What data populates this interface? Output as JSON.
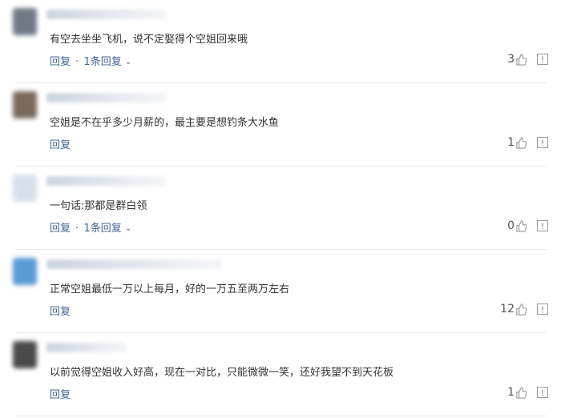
{
  "comments": [
    {
      "text": "有空去坐坐飞机，说不定娶得个空姐回来哦",
      "reply_label": "回复",
      "sub_replies": "1条回复",
      "likes": "3",
      "avatar_color": "#6f7a86"
    },
    {
      "text": "空姐是不在乎多少月薪的，最主要是想钓条大水鱼",
      "reply_label": "回复",
      "sub_replies": "",
      "likes": "1",
      "avatar_color": "#7a6a5c"
    },
    {
      "text": "一句话:那都是群白领",
      "reply_label": "回复",
      "sub_replies": "",
      "likes": "0",
      "avatar_color": "#d6e0ea"
    },
    {
      "text": "正常空姐最低一万以上每月，好的一万五至两万左右",
      "reply_label": "回复",
      "sub_replies": "",
      "likes": "12",
      "avatar_color": "#5b9bd5"
    },
    {
      "text": "以前觉得空姐收入好高，现在一对比，只能微微一笑，还好我望不到天花板",
      "reply_label": "回复",
      "sub_replies": "",
      "likes": "1",
      "avatar_color": "#4a4a4a"
    }
  ],
  "comment3_sub_replies": "1条回复",
  "icons": {
    "like": "thumbs-up-icon",
    "report": "report-icon",
    "expand": "chevron-down-icon"
  }
}
